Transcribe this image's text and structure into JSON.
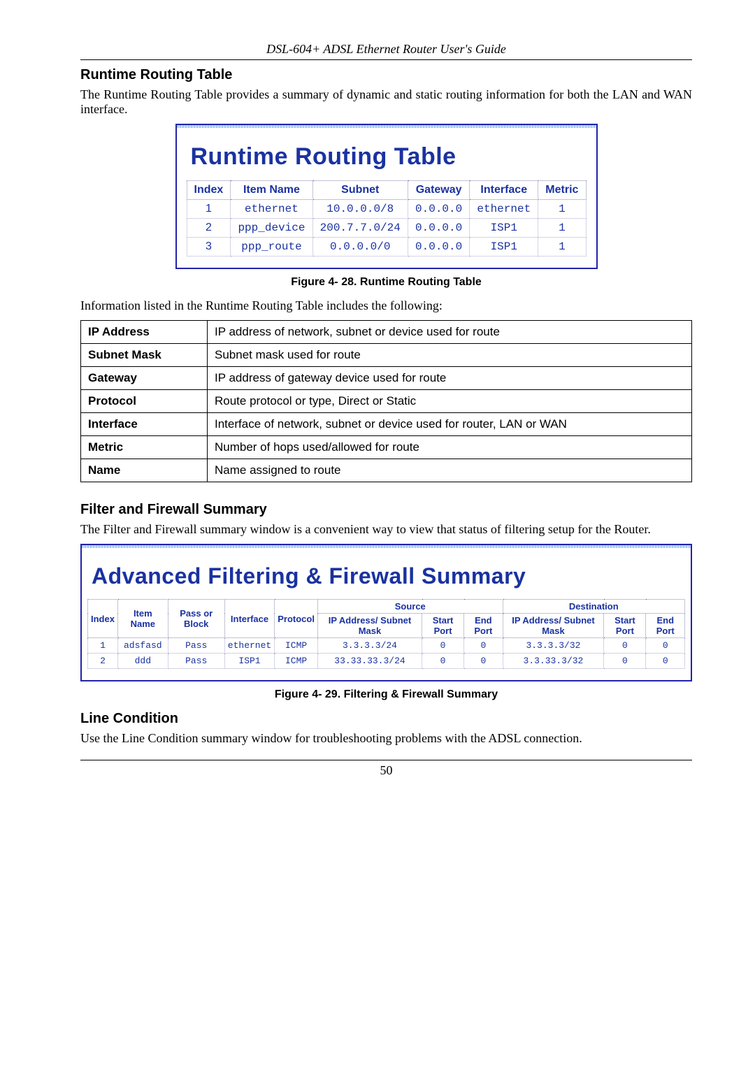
{
  "doc_header": "DSL-604+ ADSL Ethernet Router User's Guide",
  "page_number": "50",
  "sections": {
    "runtime_title": "Runtime Routing Table",
    "runtime_intro": "The Runtime Routing Table provides a summary of dynamic and static routing information for both the LAN and WAN interface.",
    "runtime_caption": "Figure 4- 28. Runtime Routing Table",
    "runtime_after": "Information listed in the Runtime Routing Table includes the following:",
    "filter_title": "Filter and Firewall Summary",
    "filter_intro": "The Filter and Firewall summary window is a convenient way to view that status of filtering setup for the Router.",
    "filter_caption": "Figure 4- 29. Filtering & Firewall Summary",
    "line_title": "Line Condition",
    "line_intro": "Use the Line Condition summary window for troubleshooting problems with the ADSL connection."
  },
  "routing_box_title": "Runtime Routing Table",
  "routing_headers": {
    "index": "Index",
    "item_name": "Item Name",
    "subnet": "Subnet",
    "gateway": "Gateway",
    "interface": "Interface",
    "metric": "Metric"
  },
  "routing_rows": [
    {
      "index": "1",
      "item_name": "ethernet",
      "subnet": "10.0.0.0/8",
      "gateway": "0.0.0.0",
      "interface": "ethernet",
      "metric": "1"
    },
    {
      "index": "2",
      "item_name": "ppp_device",
      "subnet": "200.7.7.0/24",
      "gateway": "0.0.0.0",
      "interface": "ISP1",
      "metric": "1"
    },
    {
      "index": "3",
      "item_name": "ppp_route",
      "subnet": "0.0.0.0/0",
      "gateway": "0.0.0.0",
      "interface": "ISP1",
      "metric": "1"
    }
  ],
  "chart_data": {
    "type": "table",
    "title": "Runtime Routing Table",
    "columns": [
      "Index",
      "Item Name",
      "Subnet",
      "Gateway",
      "Interface",
      "Metric"
    ],
    "rows": [
      [
        "1",
        "ethernet",
        "10.0.0.0/8",
        "0.0.0.0",
        "ethernet",
        "1"
      ],
      [
        "2",
        "ppp_device",
        "200.7.7.0/24",
        "0.0.0.0",
        "ISP1",
        "1"
      ],
      [
        "3",
        "ppp_route",
        "0.0.0.0/0",
        "0.0.0.0",
        "ISP1",
        "1"
      ]
    ]
  },
  "def_rows": [
    {
      "term": "IP Address",
      "desc": "IP address of network, subnet or device used for route"
    },
    {
      "term": "Subnet Mask",
      "desc": "Subnet mask used for route"
    },
    {
      "term": "Gateway",
      "desc": "IP address of gateway device used for route"
    },
    {
      "term": "Protocol",
      "desc": "Route protocol or type, Direct or Static"
    },
    {
      "term": "Interface",
      "desc": "Interface of network, subnet or device used for router, LAN or WAN"
    },
    {
      "term": "Metric",
      "desc": "Number of hops used/allowed for route"
    },
    {
      "term": "Name",
      "desc": "Name assigned to route"
    }
  ],
  "fw_box_title": "Advanced Filtering & Firewall Summary",
  "fw_top_headers": {
    "source": "Source",
    "destination": "Destination"
  },
  "fw_headers": {
    "index": "Index",
    "item_name": "Item Name",
    "pass_block": "Pass or Block",
    "interface": "Interface",
    "protocol": "Protocol",
    "src_ip": "IP Address/ Subnet Mask",
    "src_start": "Start Port",
    "src_end": "End Port",
    "dst_ip": "IP Address/ Subnet Mask",
    "dst_start": "Start Port",
    "dst_end": "End Port"
  },
  "fw_rows": [
    {
      "index": "1",
      "item_name": "adsfasd",
      "pass_block": "Pass",
      "interface": "ethernet",
      "protocol": "ICMP",
      "src_ip": "3.3.3.3/24",
      "src_start": "0",
      "src_end": "0",
      "dst_ip": "3.3.3.3/32",
      "dst_start": "0",
      "dst_end": "0"
    },
    {
      "index": "2",
      "item_name": "ddd",
      "pass_block": "Pass",
      "interface": "ISP1",
      "protocol": "ICMP",
      "src_ip": "33.33.33.3/24",
      "src_start": "0",
      "src_end": "0",
      "dst_ip": "3.3.33.3/32",
      "dst_start": "0",
      "dst_end": "0"
    }
  ]
}
